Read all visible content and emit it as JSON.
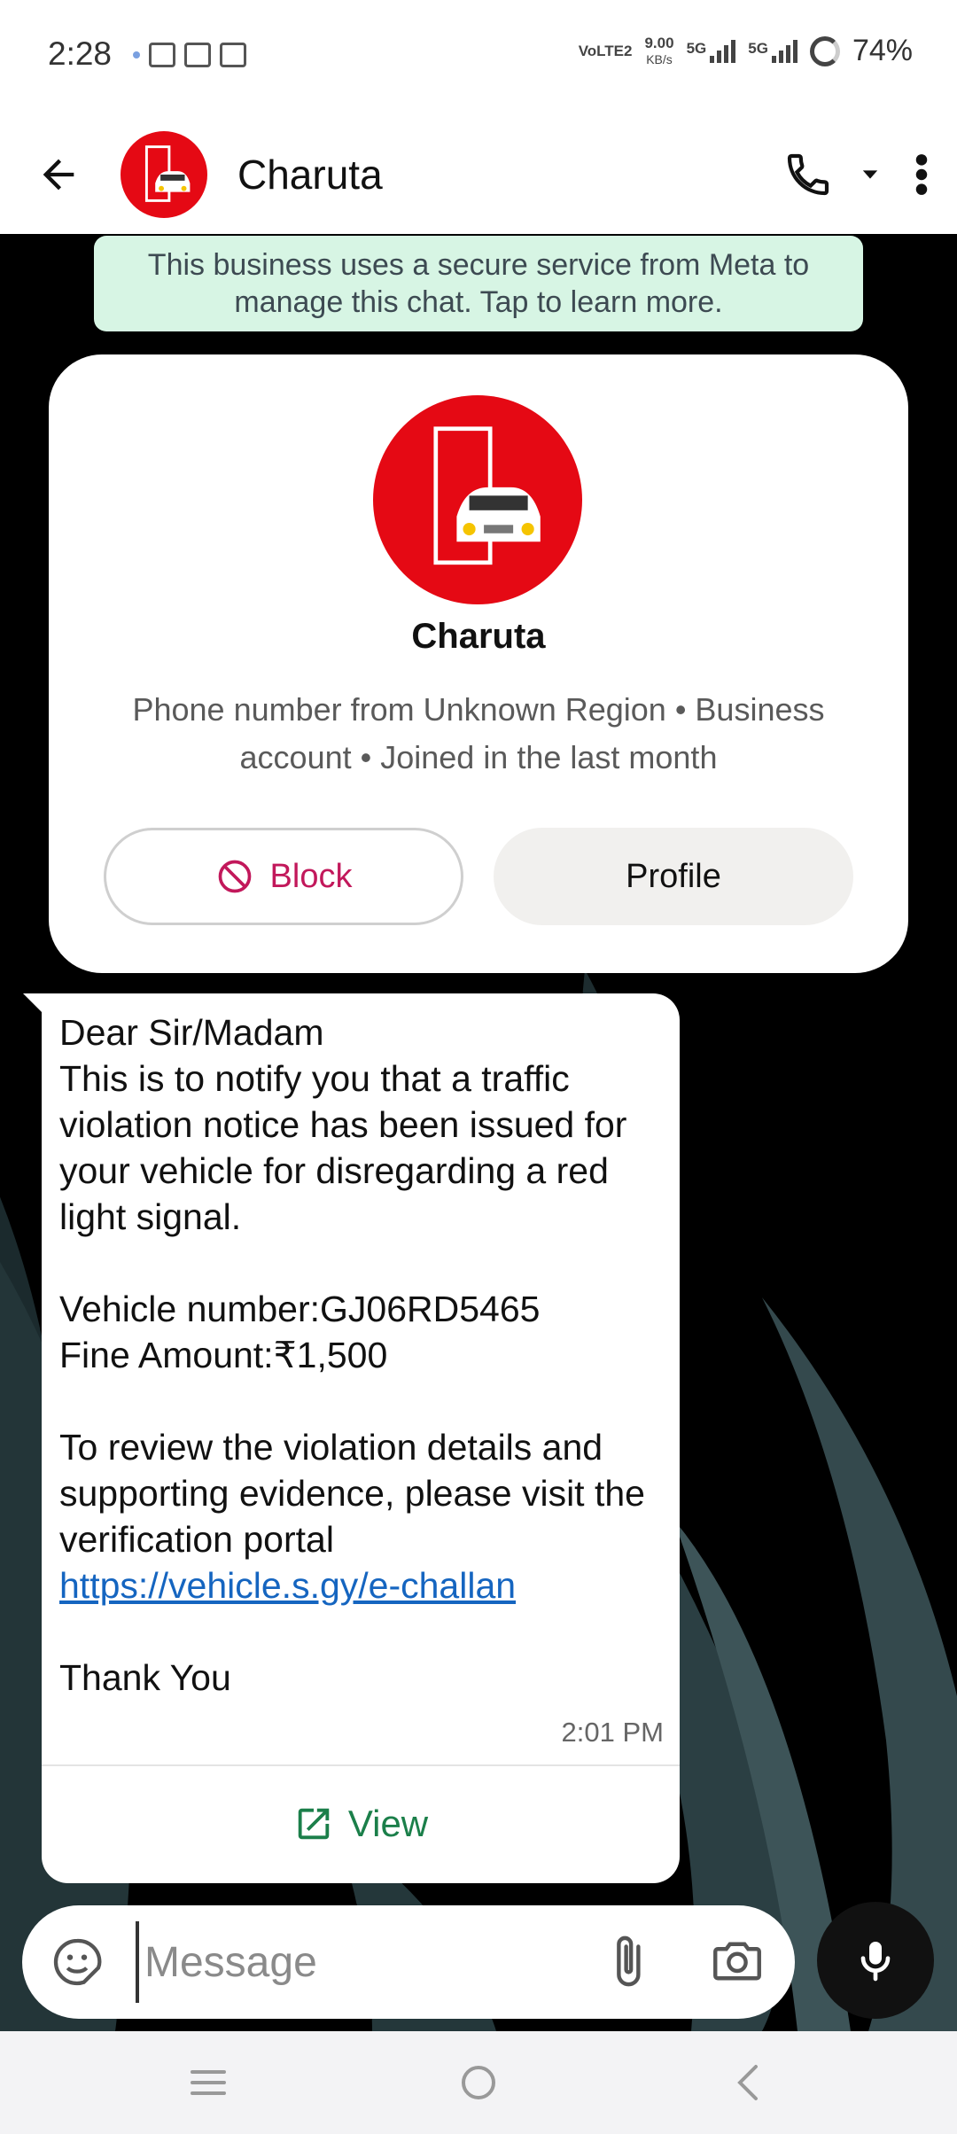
{
  "status_bar": {
    "time": "2:28",
    "volte": "VoLTE2",
    "net_speed": "9.00",
    "net_speed_unit": "KB/s",
    "net1": "5G",
    "net2": "5G",
    "battery": "74%"
  },
  "header": {
    "contact_name": "Charuta",
    "avatar_color": "#e50914"
  },
  "meta_notice": "This business uses a secure service from Meta to manage this chat. Tap to learn more.",
  "business_card": {
    "name": "Charuta",
    "subtitle": "Phone number from Unknown Region • Business account • Joined in the last month",
    "block_label": "Block",
    "profile_label": "Profile"
  },
  "message": {
    "line_greeting": "Dear Sir/Madam",
    "body_1": "This is to notify you that a traffic violation notice has been issued for your vehicle for disregarding a red light signal.",
    "vehicle": "Vehicle number:GJ06RD5465",
    "fine": "Fine Amount:₹1,500",
    "body_2": "To review the violation details and supporting evidence, please visit the verification portal",
    "link": "https://vehicle.s.gy/e-challan",
    "closing": "Thank You",
    "time": "2:01 PM",
    "action_label": "View"
  },
  "composer": {
    "placeholder": "Message"
  },
  "colors": {
    "brand_red": "#e50914",
    "link_blue": "#1565c0",
    "view_green": "#1b7f4a",
    "block_red": "#c2185b",
    "meta_banner": "#d7f5e4"
  }
}
